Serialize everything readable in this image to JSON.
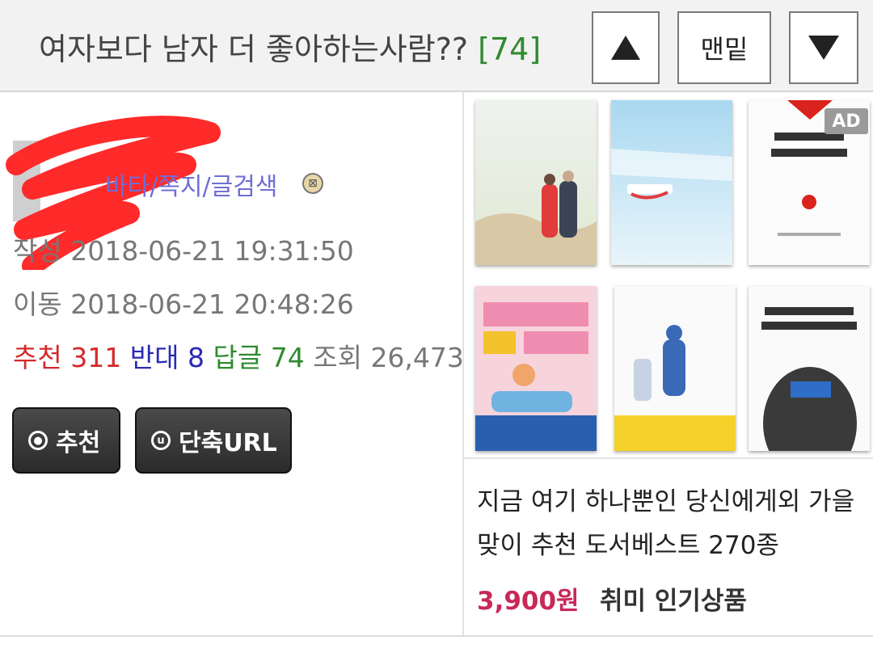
{
  "header": {
    "title": "여자보다 남자 더 좋아하는사람??",
    "comment_count": "[74]",
    "up_label": "up-arrow",
    "bottom_label": "맨밑",
    "down_label": "down-arrow"
  },
  "post": {
    "links_text": "바타/쪽지/글검색",
    "written_label": "작성",
    "written_date": "2018-06-21 19:31:50",
    "moved_label": "이동",
    "moved_date": "2018-06-21 20:48:26",
    "stats": {
      "recommend_label": "추천",
      "recommend_value": "311",
      "oppose_label": "반대",
      "oppose_value": "8",
      "reply_label": "답글",
      "reply_value": "74",
      "views_label": "조회",
      "views_value": "26,473"
    },
    "buttons": {
      "recommend_label": "추천",
      "short_url_label": "단축URL"
    }
  },
  "ad": {
    "badge": "AD",
    "description": "지금 여기 하나뿐인 당신에게외 가을맞이 추천 도서베스트 270종",
    "price": "3,900원",
    "category": "취미 인기상품"
  },
  "colors": {
    "recommend": "#d42a2a",
    "oppose": "#2a2ab4",
    "reply": "#2f8a2f",
    "price": "#c8285a"
  }
}
